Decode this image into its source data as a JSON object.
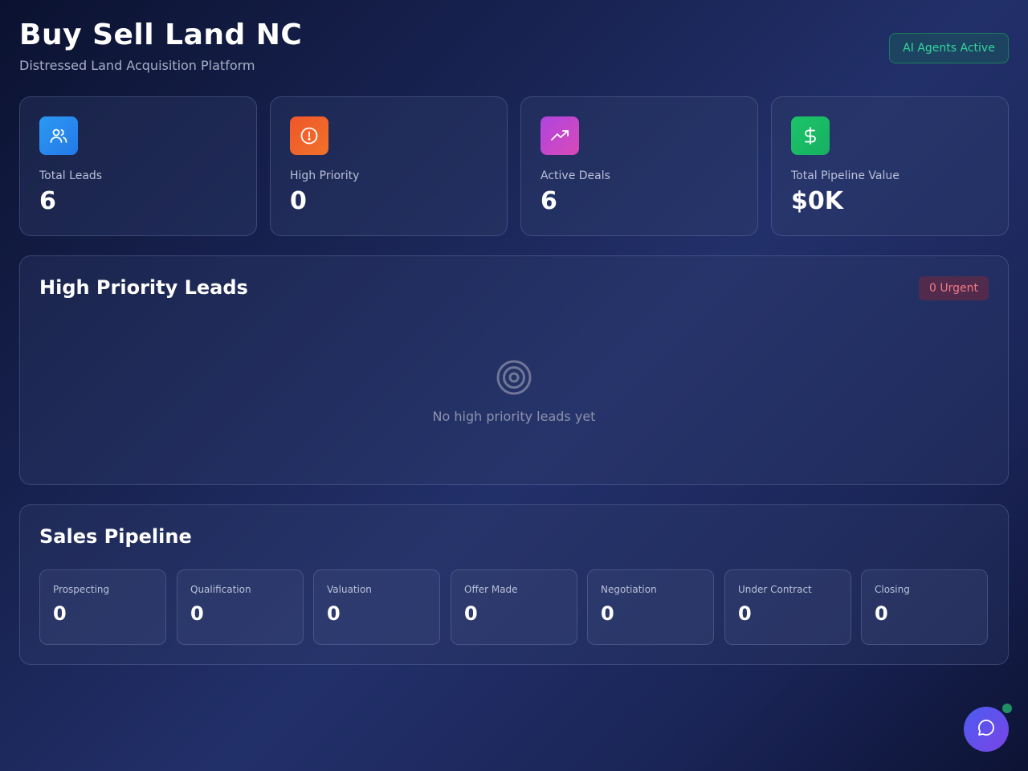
{
  "header": {
    "title": "Buy Sell Land NC",
    "subtitle": "Distressed Land Acquisition Platform",
    "status_badge": "AI Agents Active"
  },
  "stats": [
    {
      "label": "Total Leads",
      "value": "6",
      "icon": "users-icon",
      "color": "#2b8ff0"
    },
    {
      "label": "High Priority",
      "value": "0",
      "icon": "alert-circle-icon",
      "color": "#f05a28"
    },
    {
      "label": "Active Deals",
      "value": "6",
      "icon": "trending-up-icon",
      "color": "#c046d8"
    },
    {
      "label": "Total Pipeline Value",
      "value": "$0K",
      "icon": "dollar-icon",
      "color": "#1fbf6a"
    }
  ],
  "high_priority": {
    "title": "High Priority Leads",
    "badge": "0 Urgent",
    "empty_icon": "target-icon",
    "empty_text": "No high priority leads yet"
  },
  "pipeline": {
    "title": "Sales Pipeline",
    "stages": [
      {
        "label": "Prospecting",
        "value": "0"
      },
      {
        "label": "Qualification",
        "value": "0"
      },
      {
        "label": "Valuation",
        "value": "0"
      },
      {
        "label": "Offer Made",
        "value": "0"
      },
      {
        "label": "Negotiation",
        "value": "0"
      },
      {
        "label": "Under Contract",
        "value": "0"
      },
      {
        "label": "Closing",
        "value": "0"
      }
    ]
  },
  "chat": {
    "icon": "chat-bubble-icon"
  }
}
